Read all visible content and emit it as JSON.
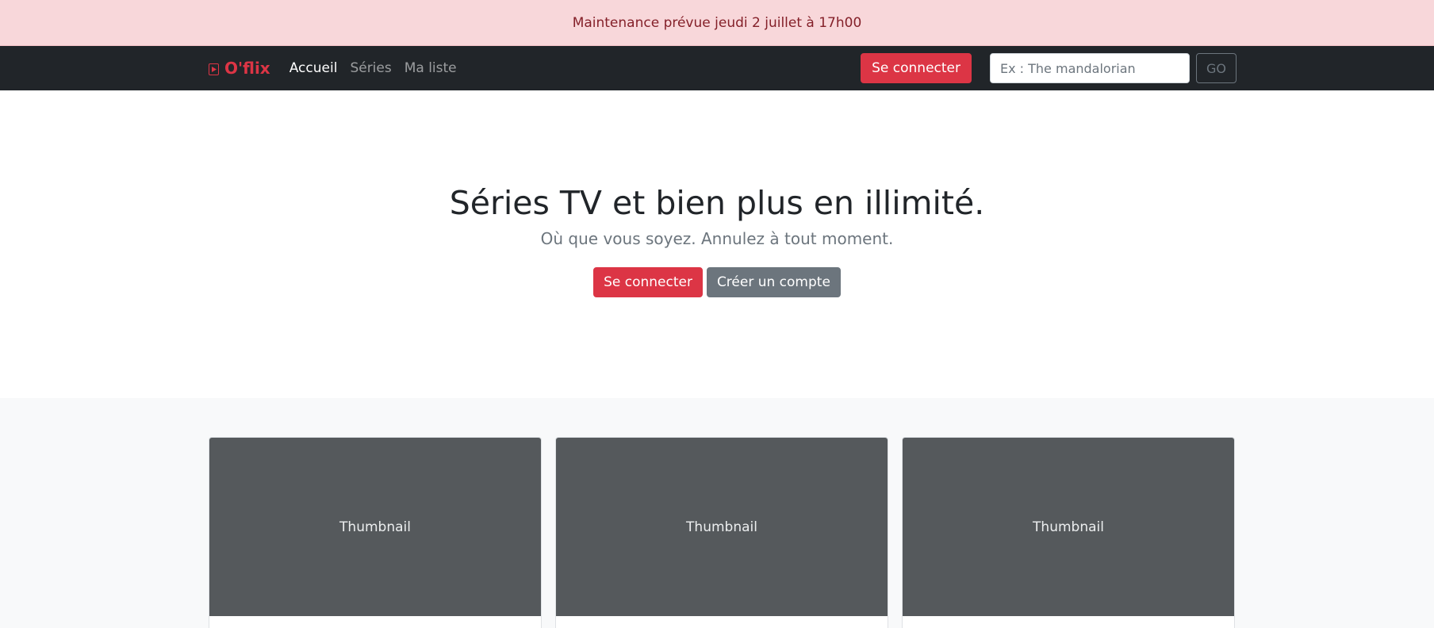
{
  "banner": {
    "text": "Maintenance prévue jeudi 2 juillet à 17h00"
  },
  "navbar": {
    "brand": "O'flix",
    "links": [
      {
        "label": "Accueil",
        "active": true
      },
      {
        "label": "Séries",
        "active": false
      },
      {
        "label": "Ma liste",
        "active": false
      }
    ],
    "login_label": "Se connecter",
    "search": {
      "placeholder": "Ex : The mandalorian",
      "value": ""
    },
    "go_label": "GO"
  },
  "hero": {
    "title": "Séries TV et bien plus en illimité.",
    "subtitle": "Où que vous soyez. Annulez à tout moment.",
    "login_label": "Se connecter",
    "signup_label": "Créer un compte"
  },
  "cards": [
    {
      "thumbnail": "Thumbnail"
    },
    {
      "thumbnail": "Thumbnail"
    },
    {
      "thumbnail": "Thumbnail"
    }
  ],
  "colors": {
    "brand": "#dc3545",
    "navbar_bg": "#212529",
    "banner_bg": "#f8d7da",
    "banner_text": "#842029",
    "thumbnail_bg": "#55595c"
  },
  "icons": {
    "brand": "play-icon"
  }
}
